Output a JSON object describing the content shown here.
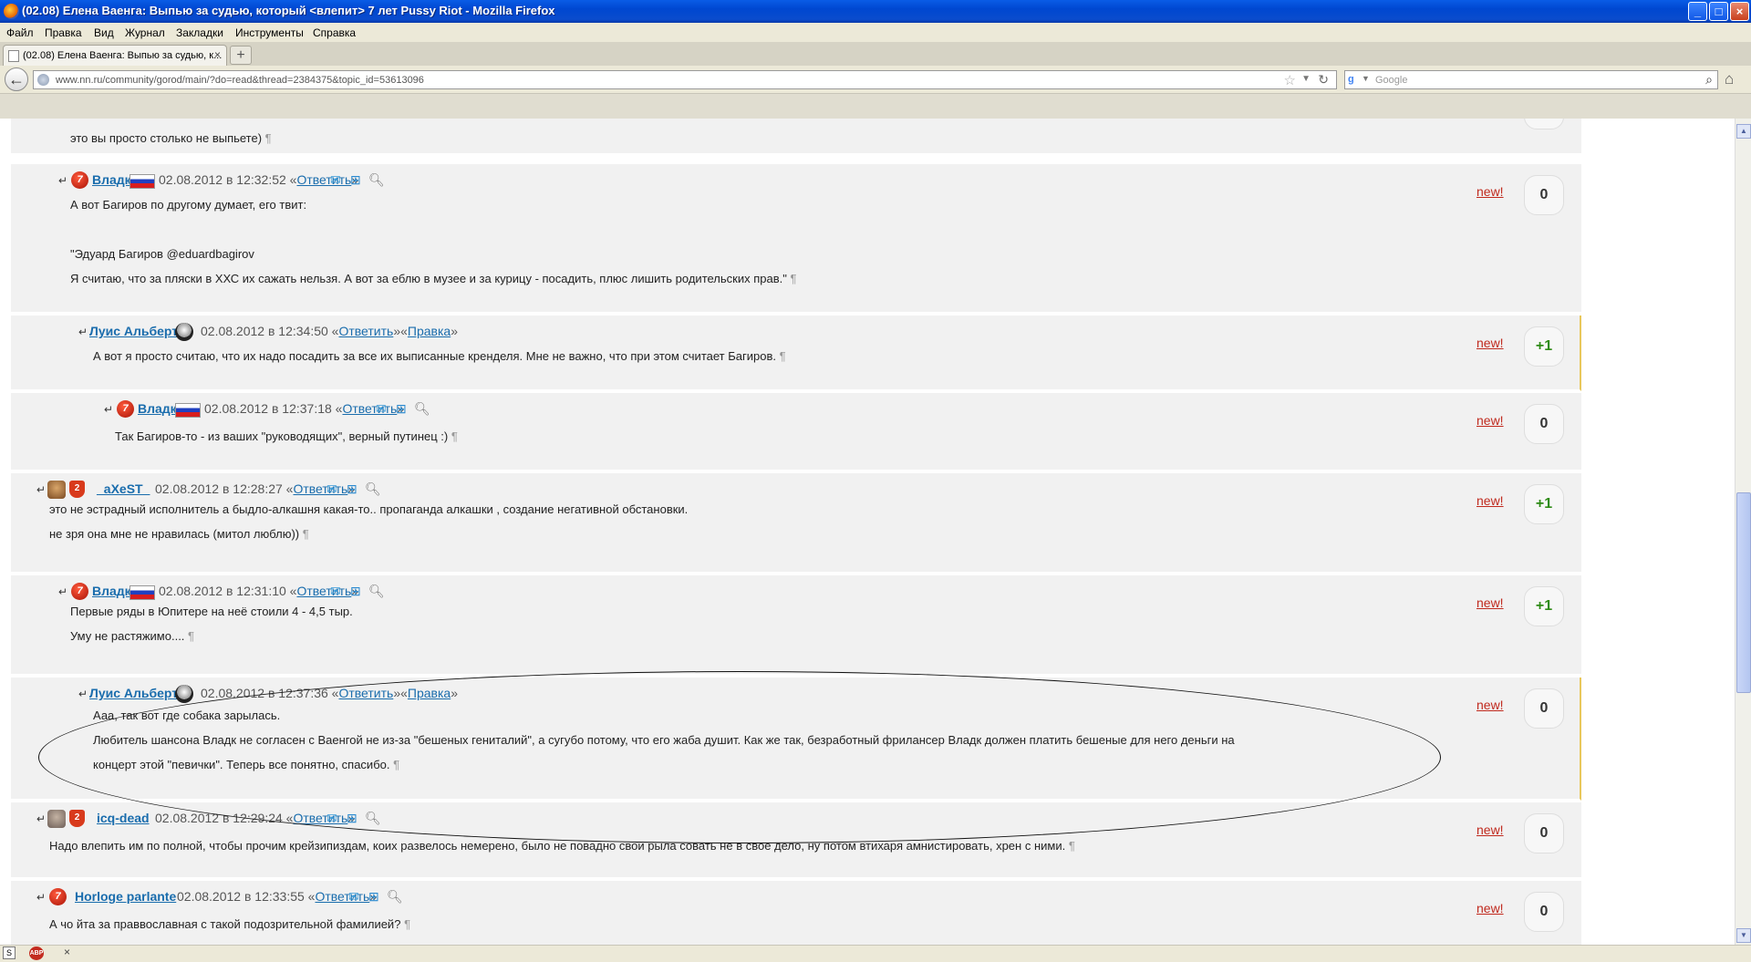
{
  "window": {
    "title": "(02.08) Елена Ваенга: Выпью за судью, который <влепит> 7 лет Pussy Riot - Mozilla Firefox",
    "minimize": "_",
    "maximize": "□",
    "close": "×"
  },
  "menu": [
    "Файл",
    "Правка",
    "Вид",
    "Журнал",
    "Закладки",
    "Инструменты",
    "Справка"
  ],
  "tab": {
    "label": "(02.08) Елена Ваенга: Выпью за судью, к...",
    "close": "×",
    "new": "+"
  },
  "nav": {
    "url": "www.nn.ru/community/gorod/main/?do=read&thread=2384375&topic_id=53613096",
    "search_placeholder": "Google"
  },
  "posts": [
    {
      "user": "",
      "date": "",
      "text": [
        "это вы просто столько не выпьете)"
      ],
      "new": "",
      "score": ""
    },
    {
      "user": "Владк",
      "date": "02.08.2012 в 12:32:52",
      "reply": "Ответить",
      "text": [
        "А вот Багиров по другому думает, его твит:",
        "",
        "\"Эдуард Багиров @eduardbagirov",
        "Я считаю, что за пляски в ХХС их сажать нельзя. А вот за еблю в музее и за курицу - посадить, плюс лишить родительских прав.\""
      ],
      "new": "new!",
      "score": "0"
    },
    {
      "user": "Луис Альберто",
      "date": "02.08.2012 в 12:34:50",
      "reply": "Ответить",
      "edit": "Правка",
      "text": [
        "А вот я просто считаю, что их надо посадить за все их выписанные кренделя. Мне не важно, что при этом считает Багиров."
      ],
      "new": "new!",
      "score": "+1"
    },
    {
      "user": "Владк",
      "date": "02.08.2012 в 12:37:18",
      "reply": "Ответить",
      "text": [
        "Так Багиров-то - из ваших \"руководящих\", верный путинец :)"
      ],
      "new": "new!",
      "score": "0"
    },
    {
      "user": "_aXeST_",
      "date": "02.08.2012 в 12:28:27",
      "reply": "Ответить",
      "badge": "2",
      "text": [
        "это не эстрадный исполнитель а быдло-алкашня какая-то.. пропаганда алкашки , создание негативной обстановки.",
        "не зря она мне не нравилась (митол люблю))"
      ],
      "new": "new!",
      "score": "+1"
    },
    {
      "user": "Владк",
      "date": "02.08.2012 в 12:31:10",
      "reply": "Ответить",
      "text": [
        "Первые ряды в Юпитере на неё стоили 4 - 4,5 тыр.",
        "Уму не растяжимо...."
      ],
      "new": "new!",
      "score": "+1"
    },
    {
      "user": "Луис Альберто",
      "date": "02.08.2012 в 12:37:36",
      "reply": "Ответить",
      "edit": "Правка",
      "text": [
        "Ааа, так вот где собака зарылась.",
        "Любитель шансона Владк не согласен с Ваенгой не из-за \"бешеных гениталий\", а сугубо потому, что его жаба душит. Как же так, безработный фрилансер Владк должен платить бешеные для него деньги на",
        "концерт этой \"певички\". Теперь все понятно, спасибо."
      ],
      "new": "new!",
      "score": "0"
    },
    {
      "user": "icq-dead",
      "date": "02.08.2012 в 12:29:24",
      "reply": "Ответить",
      "badge": "2",
      "text": [
        "Надо влепить им по полной, чтобы прочим крейзипиздам, коих развелось немерено, было не повадно свои рыла совать не в свое дело, ну потом втихаря амнистировать, хрен с ними."
      ],
      "new": "new!",
      "score": "0"
    },
    {
      "user": "Horloge parlante",
      "date": "02.08.2012 в 12:33:55",
      "reply": "Ответить",
      "text": [
        "А чо йта за праввославная с такой подозрительной фамилией?"
      ],
      "new": "new!",
      "score": "0"
    }
  ],
  "glyphs": {
    "pilcrow": "¶",
    "arrow": "↵",
    "seven": "7",
    "mail": "✉",
    "gift": "⊞",
    "key": "🔍︎",
    "open_q": "«",
    "close_q": "»"
  }
}
